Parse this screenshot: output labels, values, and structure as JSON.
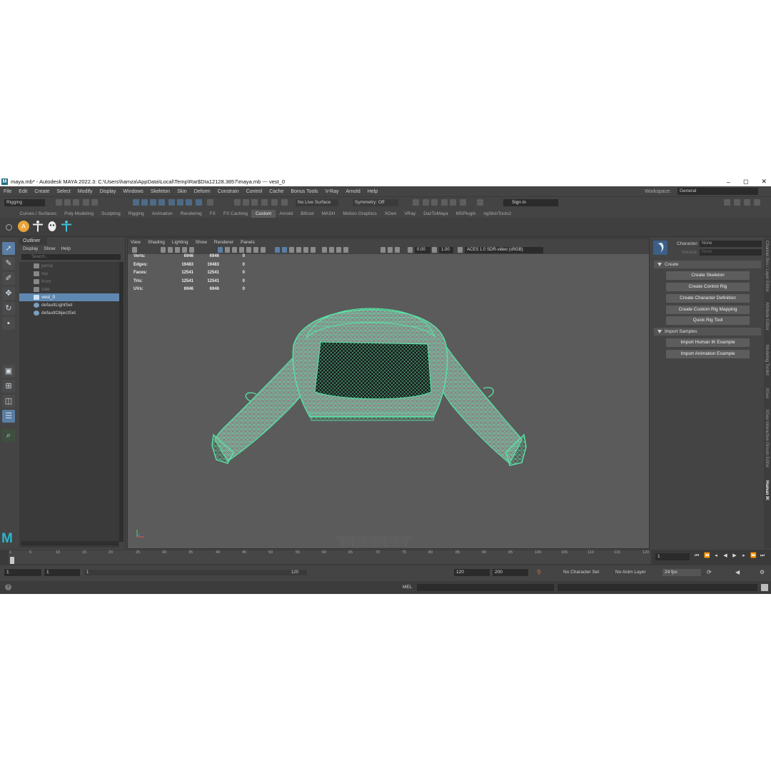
{
  "window": {
    "title": "maya.mb* - Autodesk MAYA 2022.3: C:\\Users\\hamza\\AppData\\Local\\Temp\\Rar$DIa12128.3857\\maya.mb  ---  vest_0",
    "logo": "M",
    "minimize": "–",
    "maximize": "◻",
    "close": "✕"
  },
  "menubar": [
    "File",
    "Edit",
    "Create",
    "Select",
    "Modify",
    "Display",
    "Windows",
    "Skeleton",
    "Skin",
    "Deform",
    "Constrain",
    "Control",
    "Cache",
    "Bonus Tools",
    "V-Ray",
    "Arnold",
    "Help"
  ],
  "workspace": {
    "label": "Workspace:",
    "value": "General"
  },
  "statusline": {
    "mode": "Rigging",
    "live_surface": "No Live Surface",
    "symmetry": "Symmetry: Off",
    "sign_in": "Sign in"
  },
  "shelf_tabs": [
    "Curves / Surfaces",
    "Poly Modeling",
    "Sculpting",
    "Rigging",
    "Animation",
    "Rendering",
    "FX",
    "FX Caching",
    "Custom",
    "Arnold",
    "Bifrost",
    "MASH",
    "Motion Graphics",
    "XGen",
    "VRay",
    "DazToMaya",
    "MSPlugin",
    "ngSkinTools2"
  ],
  "shelf_active": "Custom",
  "outliner": {
    "title": "Outliner",
    "menu": [
      "Display",
      "Show",
      "Help"
    ],
    "search_placeholder": "Search...",
    "items": [
      {
        "label": "persp",
        "dim": true
      },
      {
        "label": "top",
        "dim": true
      },
      {
        "label": "front",
        "dim": true
      },
      {
        "label": "side",
        "dim": true
      },
      {
        "label": "vest_0",
        "selected": true
      },
      {
        "label": "defaultLightSet"
      },
      {
        "label": "defaultObjectSet"
      }
    ]
  },
  "viewport": {
    "menu": [
      "View",
      "Shading",
      "Lighting",
      "Show",
      "Renderer",
      "Panels"
    ],
    "exposure": "0.00",
    "gamma": "1.00",
    "color_space": "ACES 1.0 SDR-video (sRGB)",
    "hud": [
      {
        "label": "Verts:",
        "a": "6946",
        "b": "6946",
        "c": "0"
      },
      {
        "label": "Edges:",
        "a": "19483",
        "b": "19483",
        "c": "0"
      },
      {
        "label": "Faces:",
        "a": "12541",
        "b": "12541",
        "c": "0"
      },
      {
        "label": "Tris:",
        "a": "12541",
        "b": "12541",
        "c": "0"
      },
      {
        "label": "UVs:",
        "a": "6946",
        "b": "6946",
        "c": "0"
      }
    ],
    "wire_color": "#57e6a6"
  },
  "human_ik": {
    "character_label": "Character:",
    "character_value": "None",
    "source_label": "Source:",
    "source_value": "None",
    "create_section": "Create",
    "create_buttons": [
      "Create Skeleton",
      "Create Control Rig",
      "Create Character Definition",
      "Create Custom Rig Mapping",
      "Quick Rig Tool"
    ],
    "import_section": "Import Samples",
    "import_buttons": [
      "Import Human IK Example",
      "Import Animation Example"
    ]
  },
  "right_tabs": [
    "Channel Box / Layer Editor",
    "Attribute Editor",
    "Modeling Toolkit",
    "XGen",
    "XGen Interactive Groom Editor",
    "Human IK"
  ],
  "timeline": {
    "ticks": [
      "1",
      "5",
      "10",
      "15",
      "20",
      "25",
      "30",
      "35",
      "40",
      "45",
      "50",
      "55",
      "60",
      "65",
      "70",
      "75",
      "80",
      "85",
      "90",
      "95",
      "100",
      "105",
      "110",
      "115",
      "120"
    ],
    "current_frame": "1"
  },
  "range": {
    "start": "1",
    "inner_start": "1",
    "slider_start": "1",
    "slider_end": "120",
    "end": "120",
    "outer_end": "200",
    "character_set": "No Character Set",
    "anim_layer": "No Anim Layer",
    "fps": "24 fps"
  },
  "cmdline": {
    "lang": "MEL"
  }
}
